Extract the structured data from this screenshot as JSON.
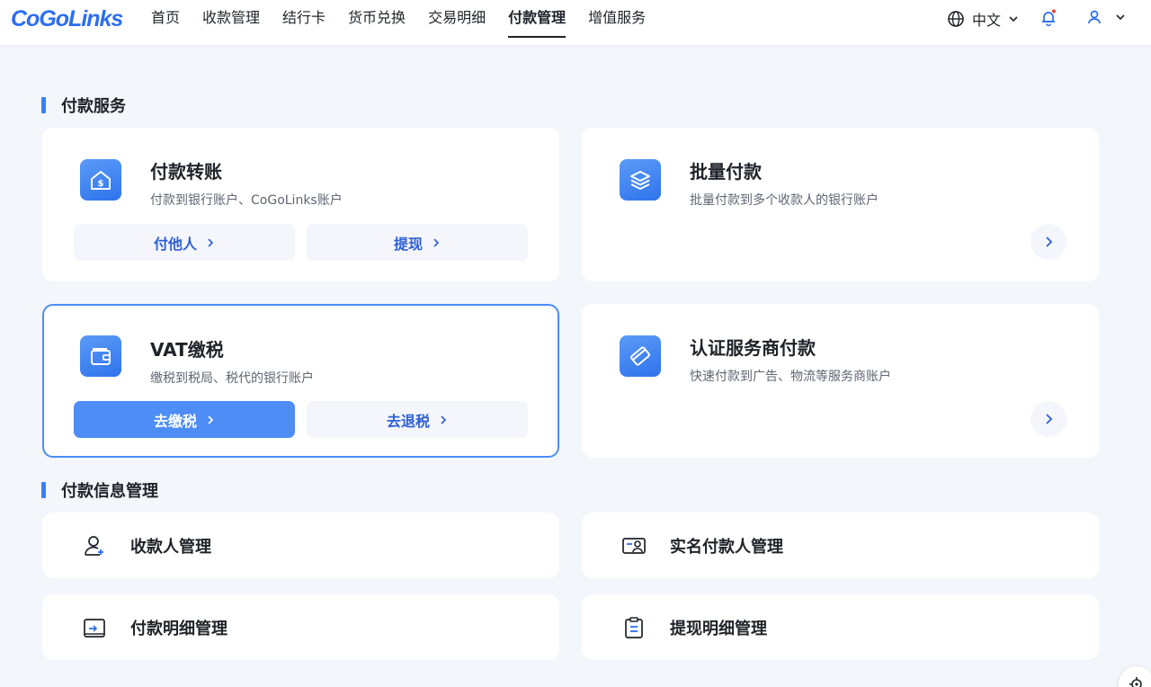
{
  "header": {
    "logo": "CoGoLinks",
    "nav": [
      {
        "label": "首页"
      },
      {
        "label": "收款管理"
      },
      {
        "label": "结行卡"
      },
      {
        "label": "货币兑换"
      },
      {
        "label": "交易明细"
      },
      {
        "label": "付款管理",
        "active": true
      },
      {
        "label": "增值服务"
      }
    ],
    "language": "中文"
  },
  "payment_services": {
    "title": "付款服务",
    "cards": [
      {
        "title": "付款转账",
        "desc": "付款到银行账户、CoGoLinks账户",
        "icon": "house-dollar-icon",
        "buttons": [
          {
            "label": "付他人"
          },
          {
            "label": "提现"
          }
        ]
      },
      {
        "title": "批量付款",
        "desc": "批量付款到多个收款人的银行账户",
        "icon": "layers-icon"
      },
      {
        "title": "VAT缴税",
        "desc": "缴税到税局、税代的银行账户",
        "icon": "wallet-icon",
        "buttons": [
          {
            "label": "去缴税"
          },
          {
            "label": "去退税"
          }
        ]
      },
      {
        "title": "认证服务商付款",
        "desc": "快速付款到广告、物流等服务商账户",
        "icon": "card-tilt-icon"
      }
    ]
  },
  "payment_info": {
    "title": "付款信息管理",
    "items": [
      {
        "label": "收款人管理",
        "icon": "user-add-icon"
      },
      {
        "label": "实名付款人管理",
        "icon": "id-card-icon"
      },
      {
        "label": "付款明细管理",
        "icon": "receipt-icon"
      },
      {
        "label": "提现明细管理",
        "icon": "clipboard-icon"
      }
    ]
  },
  "colors": {
    "accent": "#3b7ff5",
    "link": "#2d5fd6",
    "background": "#f3f6fb"
  }
}
